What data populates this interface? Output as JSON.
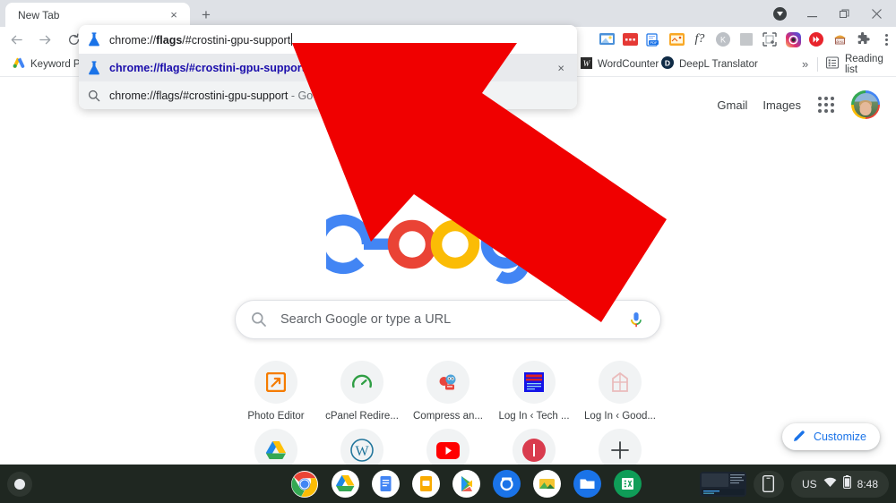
{
  "window": {
    "tab": {
      "title": "New Tab",
      "close_label": "×"
    },
    "new_tab_button": "+",
    "controls": {
      "profile_badge": "▼",
      "minimize": "—",
      "maximize": "❐",
      "close": "✕"
    }
  },
  "toolbar": {
    "back": "←",
    "forward": "→",
    "reload": "⟳",
    "extensions": [
      {
        "name": "screencast-extension-icon",
        "color": "#4a90d9"
      },
      {
        "name": "wordcounter-red-extension-icon",
        "color": "#e53935"
      },
      {
        "name": "pdf-converter-extension-icon",
        "color": "#1a73e8"
      },
      {
        "name": "note-extension-icon",
        "color": "#f9a825"
      },
      {
        "name": "fontface-ninja-extension-icon",
        "glyph": "f?"
      },
      {
        "name": "kami-extension-icon",
        "glyph": "K"
      },
      {
        "name": "grey-square-extension-icon",
        "color": "#bdc1c6"
      },
      {
        "name": "screenshot-capture-extension-icon",
        "color": "#5f6368"
      },
      {
        "name": "instagram-extension-icon",
        "color": "#e1306c"
      },
      {
        "name": "video-speed-extension-icon",
        "color": "#e53935"
      },
      {
        "name": "desc-extension-icon",
        "glyph": "desc"
      },
      {
        "name": "puzzle-extensions-icon",
        "color": "#5f6368"
      }
    ],
    "menu": "⋮"
  },
  "bookmarks": {
    "items": [
      {
        "label": "Keyword Pla",
        "icon": "google-ads-icon"
      },
      {
        "label": "WordCounter",
        "icon": "wordcounter-icon"
      },
      {
        "label": "DeepL Translator",
        "icon": "deepl-icon"
      }
    ],
    "overflow": "»",
    "reading_list": "Reading list"
  },
  "omnibox": {
    "typed_value": "chrome://flags/#crostini-gpu-support",
    "typed_prefix": "chrome://",
    "typed_bold": "flags",
    "typed_suffix": "/#crostini-gpu-support",
    "suggestions": [
      {
        "text": "chrome://flags/#crostini-gpu-support",
        "icon": "flask-icon",
        "selected": true,
        "dismiss": "×"
      },
      {
        "text": "chrome://flags/#crostini-gpu-support",
        "suffix": " - Go",
        "icon": "search-icon",
        "selected": false
      }
    ]
  },
  "ntp": {
    "gmail_label": "Gmail",
    "images_label": "Images",
    "apps_icon": "apps-grid-icon",
    "avatar": "user-avatar",
    "logo": "google-logo",
    "search": {
      "placeholder": "Search Google or type a URL",
      "search_icon": "search-icon",
      "mic_icon": "microphone-icon"
    },
    "shortcuts": [
      {
        "label": "Photo Editor",
        "icon": "photo-editor-icon"
      },
      {
        "label": "cPanel Redire...",
        "icon": "cpanel-icon"
      },
      {
        "label": "Compress an...",
        "icon": "compress-robot-icon"
      },
      {
        "label": "Log In ‹ Tech ...",
        "icon": "techblue-icon"
      },
      {
        "label": "Log In ‹ Good...",
        "icon": "goodlogin-icon"
      },
      {
        "label": "",
        "icon": "google-drive-icon"
      },
      {
        "label": "",
        "icon": "wordpress-icon"
      },
      {
        "label": "",
        "icon": "youtube-icon"
      },
      {
        "label": "",
        "icon": "red-circle-icon"
      },
      {
        "label": "",
        "icon": "add-shortcut-icon"
      }
    ],
    "customize": {
      "label": "Customize",
      "icon": "pencil-icon"
    }
  },
  "shelf": {
    "launcher": "launcher-button",
    "apps": [
      {
        "name": "chrome-app-icon",
        "running": true
      },
      {
        "name": "google-drive-app-icon",
        "running": false
      },
      {
        "name": "google-docs-app-icon",
        "running": false
      },
      {
        "name": "google-slides-app-icon",
        "running": false
      },
      {
        "name": "play-store-app-icon",
        "running": false
      },
      {
        "name": "camera-app-icon",
        "running": false
      },
      {
        "name": "gallery-app-icon",
        "running": false
      },
      {
        "name": "files-app-icon",
        "running": false
      },
      {
        "name": "google-sheets-app-icon",
        "running": false
      }
    ],
    "status": {
      "keyboard_layout": "US",
      "wifi_icon": "wifi-icon",
      "battery_icon": "battery-icon",
      "time": "8:48"
    },
    "tray_preview": "window-preview-thumbnail",
    "phone_hub": "phone-hub-icon"
  },
  "annotation": {
    "arrow": "red-pointer-arrow",
    "color": "#f00000"
  },
  "colors": {
    "tabstrip_bg": "#dee1e6",
    "shelf_bg": "#1f2721",
    "accent_blue": "#1a73e8",
    "arrow_red": "#f00000"
  }
}
